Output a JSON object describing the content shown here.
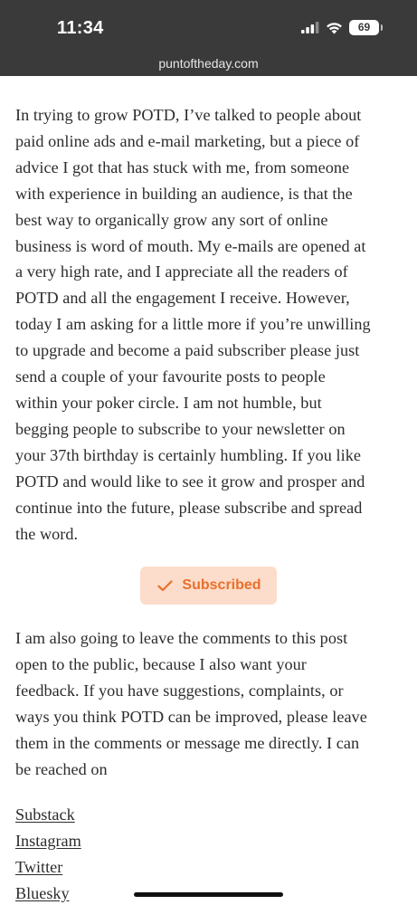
{
  "status_bar": {
    "time": "11:34",
    "battery": "69",
    "url": "puntoftheday.com"
  },
  "article": {
    "paragraph1": [
      "In trying to grow POTD, I’ve talked to people about",
      "paid online ads and e-mail marketing, but a piece of",
      "advice I got that has stuck with me, from someone",
      "with experience in building an audience, is that the",
      "best way to organically grow any sort of online",
      "business is word of mouth. My e-mails are opened at",
      "a very high rate, and I appreciate all the readers of",
      "POTD and all the engagement I receive. However,",
      "today I am asking for a little more if you’re unwilling",
      "to upgrade and become a paid subscriber please just",
      "send a couple of your favourite posts to people",
      "within your poker circle. I am not humble, but",
      "begging people to subscribe to your newsletter on",
      "your 37th birthday is certainly humbling. If you like",
      "POTD and would like to see it grow and prosper and",
      "continue into the future, please subscribe and spread",
      "the word."
    ],
    "subscribed_label": "Subscribed",
    "paragraph2": [
      "I am also going to leave the comments to this post",
      "open to the public, because I also want your",
      "feedback. If you have suggestions, complaints, or",
      "ways you think POTD can be improved, please leave",
      "them in the comments or message me directly. I can",
      "be reached on"
    ],
    "links": [
      "Substack",
      "Instagram",
      "Twitter",
      "Bluesky"
    ]
  },
  "colors": {
    "status_bar_bg": "#3a3a3a",
    "accent": "#e8702b",
    "button_bg": "#fcdccb"
  }
}
